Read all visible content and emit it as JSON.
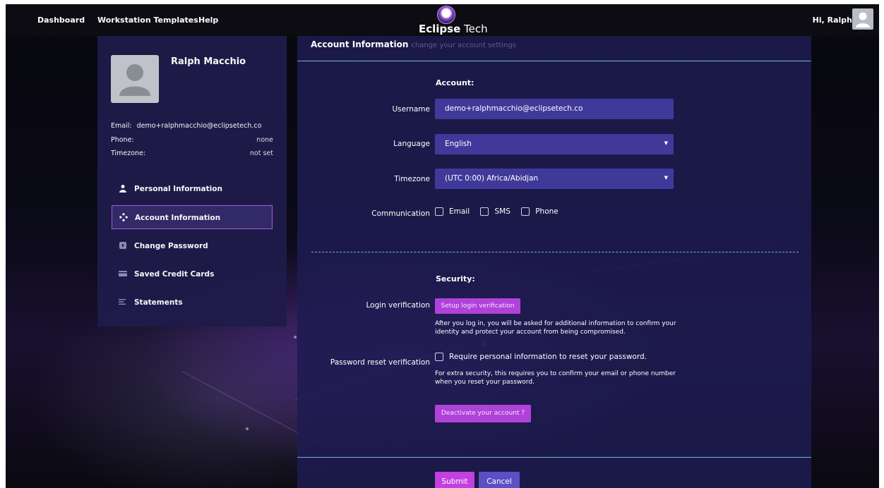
{
  "nav": {
    "dashboard": "Dashboard",
    "workstation_templates": "Workstation Templates",
    "help": "Help",
    "greeting": "Hi, Ralph"
  },
  "brand": {
    "name_bold": "Eclipse",
    "name_light": " Tech"
  },
  "profile": {
    "name": "Ralph Macchio",
    "email_label": "Email:",
    "email_value": "demo+ralphmacchio@eclipsetech.co",
    "phone_label": "Phone:",
    "phone_value": "none",
    "timezone_label": "Timezone:",
    "timezone_value": "not set"
  },
  "sidebar": {
    "items": [
      {
        "label": "Personal Information",
        "icon": "user-icon"
      },
      {
        "label": "Account Information",
        "icon": "network-icon",
        "active": true
      },
      {
        "label": "Change Password",
        "icon": "shield-icon"
      },
      {
        "label": "Saved Credit Cards",
        "icon": "card-icon"
      },
      {
        "label": "Statements",
        "icon": "lines-icon"
      }
    ]
  },
  "main": {
    "title": "Account Information",
    "subtitle": "change your account settings",
    "account_section": "Account:",
    "username_label": "Username",
    "username_value": "demo+ralphmacchio@eclipsetech.co",
    "language_label": "Language",
    "language_value": "English",
    "timezone_label": "Timezone",
    "timezone_value": "(UTC 0:00) Africa/Abidjan",
    "communication_label": "Communication",
    "comm_options": [
      "Email",
      "SMS",
      "Phone"
    ],
    "security_section": "Security:",
    "login_verification_label": "Login verification",
    "setup_login_button": "Setup login verification",
    "login_help": "After you log in, you will be asked for additional information to confirm your identity and protect your account from being compromised.",
    "password_reset_label": "Password reset verification",
    "password_reset_check": "Require personal information to reset your password.",
    "password_reset_help": "For extra security, this requires you to confirm your email or phone number when you reset your password.",
    "deactivate_button": "Deactivate your account ?",
    "submit": "Submit",
    "cancel": "Cancel"
  },
  "colors": {
    "accent": "#b042d8",
    "field_bg": "#3f3a9a",
    "panel_bg": "#1f1b4a",
    "rule": "#6fb6d8"
  }
}
